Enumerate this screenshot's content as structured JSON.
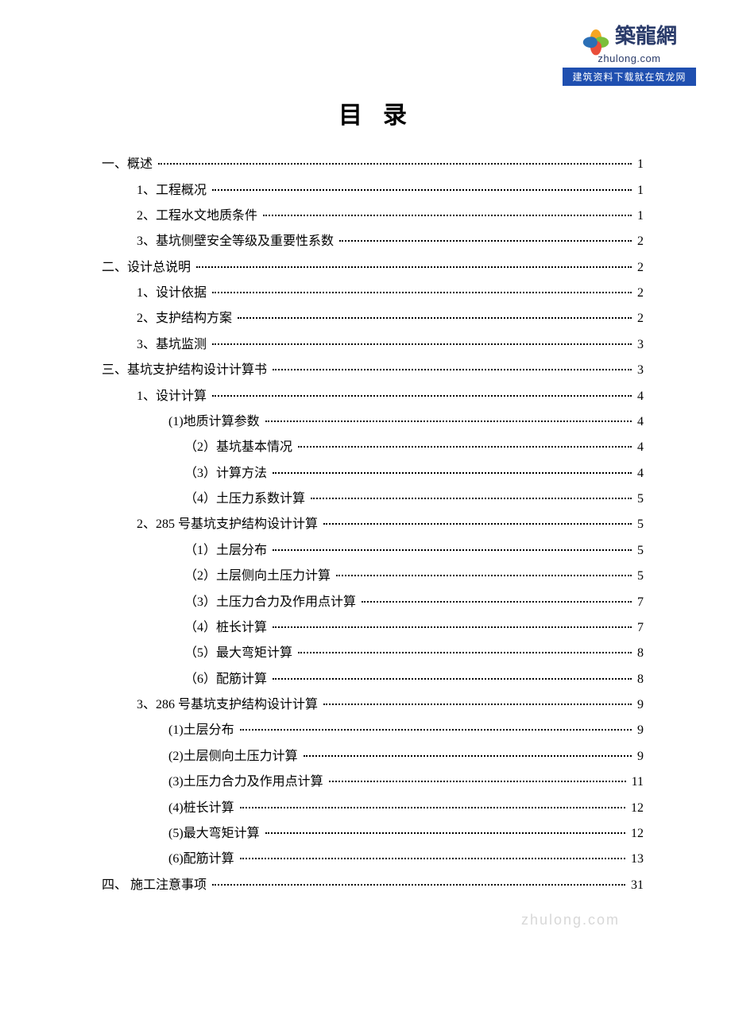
{
  "logo": {
    "brand_cn": "築龍網",
    "brand_en": "zhulong.com",
    "banner": "建筑资料下载就在筑龙网",
    "petal_colors": [
      "#f5a623",
      "#7bbf3a",
      "#e94e3a",
      "#2b6fb6"
    ]
  },
  "title": "目录",
  "watermark": "zhulong.com",
  "toc": [
    {
      "level": 0,
      "label": "一、概述",
      "page": "1"
    },
    {
      "level": 1,
      "label": "1、工程概况",
      "page": "1"
    },
    {
      "level": 1,
      "label": "2、工程水文地质条件",
      "page": "1"
    },
    {
      "level": 1,
      "label": "3、基坑侧壁安全等级及重要性系数",
      "page": "2"
    },
    {
      "level": 0,
      "label": "二、设计总说明",
      "page": "2"
    },
    {
      "level": 1,
      "label": "1、设计依据",
      "page": "2"
    },
    {
      "level": 1,
      "label": "2、支护结构方案",
      "page": "2"
    },
    {
      "level": 1,
      "label": "3、基坑监测",
      "page": "3"
    },
    {
      "level": 0,
      "label": "三、基坑支护结构设计计算书",
      "page": "3"
    },
    {
      "level": 1,
      "label": "1、设计计算",
      "page": "4"
    },
    {
      "level": 2,
      "label": "(1)地质计算参数",
      "page": "4"
    },
    {
      "level": 3,
      "label": "（2）基坑基本情况",
      "page": "4"
    },
    {
      "level": 3,
      "label": "（3）计算方法",
      "page": "4"
    },
    {
      "level": 3,
      "label": "（4）土压力系数计算",
      "page": "5"
    },
    {
      "level": 1,
      "label": "2、285 号基坑支护结构设计计算",
      "page": "5"
    },
    {
      "level": 3,
      "label": "（1）土层分布",
      "page": "5"
    },
    {
      "level": 3,
      "label": "（2）土层侧向土压力计算",
      "page": "5"
    },
    {
      "level": 3,
      "label": "（3）土压力合力及作用点计算",
      "page": "7"
    },
    {
      "level": 3,
      "label": "（4）桩长计算",
      "page": "7"
    },
    {
      "level": 3,
      "label": "（5）最大弯矩计算",
      "page": "8"
    },
    {
      "level": 3,
      "label": "（6）配筋计算",
      "page": "8"
    },
    {
      "level": 1,
      "label": "3、286 号基坑支护结构设计计算",
      "page": "9"
    },
    {
      "level": 2,
      "label": "(1)土层分布",
      "page": "9"
    },
    {
      "level": 2,
      "label": "(2)土层侧向土压力计算",
      "page": "9"
    },
    {
      "level": 2,
      "label": "(3)土压力合力及作用点计算",
      "page": "11"
    },
    {
      "level": 2,
      "label": "(4)桩长计算",
      "page": "12"
    },
    {
      "level": 2,
      "label": "(5)最大弯矩计算",
      "page": "12"
    },
    {
      "level": 2,
      "label": "(6)配筋计算",
      "page": "13"
    },
    {
      "level": 0,
      "label": "四、 施工注意事项",
      "page": "31"
    }
  ]
}
